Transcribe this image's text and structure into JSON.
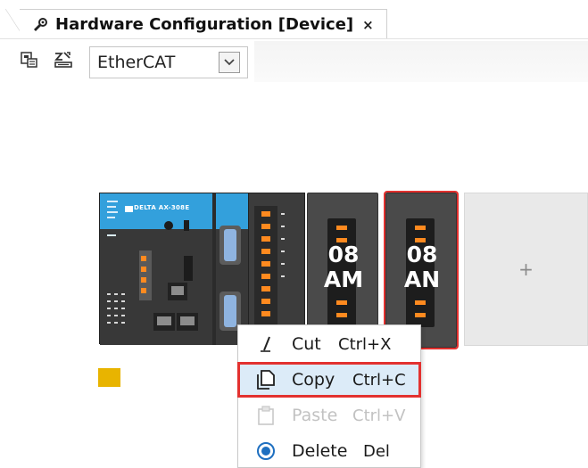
{
  "tab": {
    "title": "Hardware Configuration [Device]",
    "close_glyph": "×",
    "icon": "hardware-config-icon"
  },
  "toolbar": {
    "bus_select_value": "EtherCAT",
    "buttons": [
      "device-view-icon",
      "scan-network-icon"
    ]
  },
  "rack": {
    "cpu_brand": "DELTA AX-308E",
    "modules": [
      {
        "top": "08",
        "bottom": "AM",
        "selected": false
      },
      {
        "top": "08",
        "bottom": "AN",
        "selected": true
      }
    ],
    "add_slot_glyph": "+"
  },
  "context_menu": {
    "items": [
      {
        "label": "Cut",
        "shortcut": "Ctrl+X",
        "icon": "cut-icon",
        "enabled": true
      },
      {
        "label": "Copy",
        "shortcut": "Ctrl+C",
        "icon": "copy-icon",
        "enabled": true,
        "highlighted": true
      },
      {
        "label": "Paste",
        "shortcut": "Ctrl+V",
        "icon": "paste-icon",
        "enabled": false
      },
      {
        "label": "Delete",
        "shortcut": "Del",
        "icon": "delete-icon",
        "enabled": true
      }
    ]
  },
  "colors": {
    "highlight_border": "#e3312f",
    "highlight_fill": "#dcebf8",
    "module_label": "#ffffff",
    "status_square": "#e8b400",
    "cpu_accent": "#33a0dc"
  }
}
